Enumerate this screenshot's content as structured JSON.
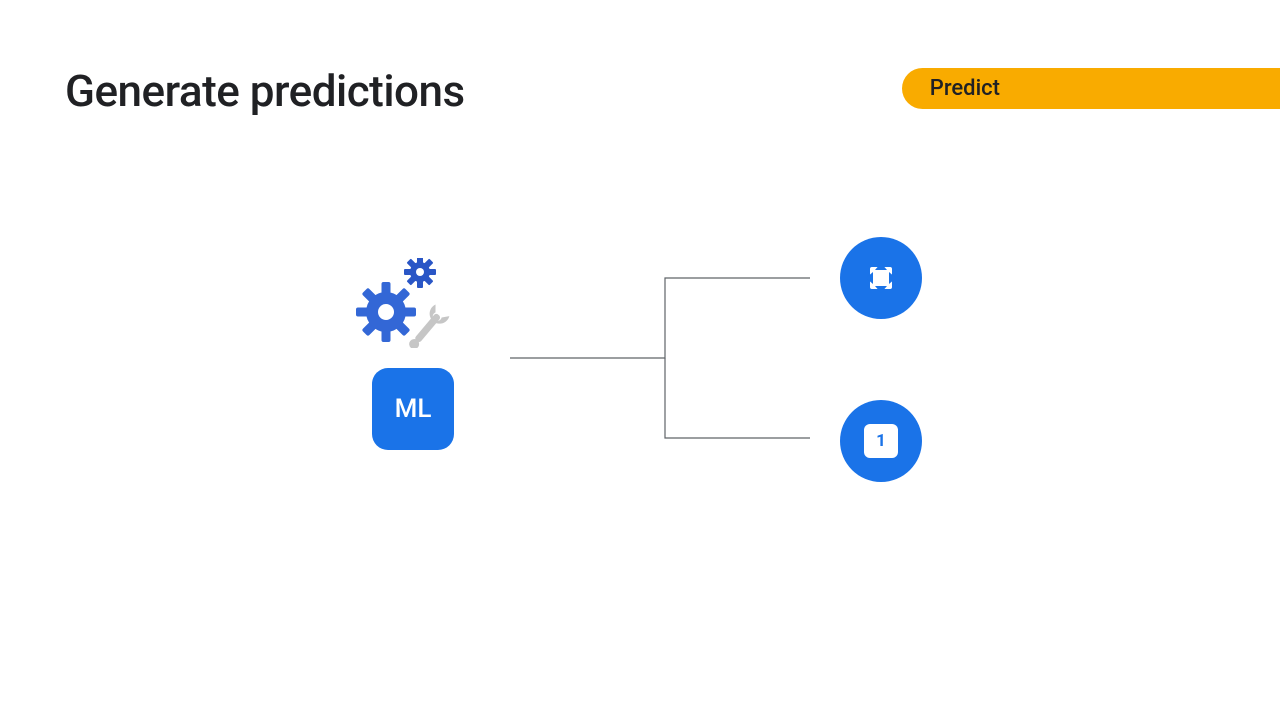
{
  "title": "Generate predictions",
  "pill": "Predict",
  "ml_label": "ML",
  "one_label": "1",
  "colors": {
    "accent_blue": "#1a73e8",
    "accent_orange": "#f9ab00",
    "text_dark": "#202124"
  }
}
